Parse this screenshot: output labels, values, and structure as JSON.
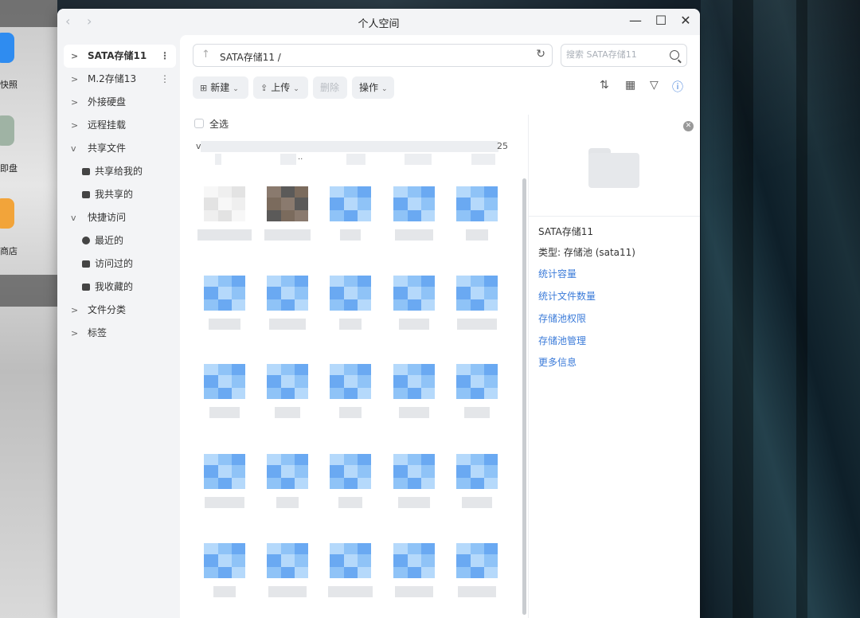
{
  "window": {
    "title": "个人空间",
    "controls": {
      "minimize": "—",
      "maximize": "☐",
      "close": "✕"
    }
  },
  "desktop": {
    "labels": [
      "快照",
      "即盘",
      "商店"
    ]
  },
  "sidebar": {
    "items": [
      {
        "label": "SATA存储11",
        "active": true,
        "has_more": true
      },
      {
        "label": "M.2存储13",
        "has_more": true
      },
      {
        "label": "外接硬盘"
      },
      {
        "label": "远程挂载"
      },
      {
        "label": "共享文件",
        "expanded": true
      },
      {
        "label": "共享给我的",
        "sub": true,
        "icon": "share-in-icon"
      },
      {
        "label": "我共享的",
        "sub": true,
        "icon": "share-out-icon"
      },
      {
        "label": "快捷访问",
        "expanded": true
      },
      {
        "label": "最近的",
        "sub": true,
        "icon": "clock-icon"
      },
      {
        "label": "访问过的",
        "sub": true,
        "icon": "visited-folder-icon"
      },
      {
        "label": "我收藏的",
        "sub": true,
        "icon": "star-folder-icon"
      },
      {
        "label": "文件分类"
      },
      {
        "label": "标签"
      }
    ]
  },
  "pathbar": {
    "path": "SATA存储11 /"
  },
  "search": {
    "placeholder": "搜索 SATA存储11"
  },
  "toolbar": {
    "new_label": "新建",
    "upload_label": "上传",
    "delete_label": "删除",
    "actions_label": "操作"
  },
  "file_area": {
    "select_all_label": "全选",
    "partial_text_left": "v",
    "partial_text_right": "25",
    "partial_text_mid": ".."
  },
  "details": {
    "name": "SATA存储11",
    "type_label": "类型:",
    "type_value": "存储池 (sata11)",
    "links": [
      "统计容量",
      "统计文件数量",
      "存储池权限",
      "存储池管理",
      "更多信息"
    ]
  },
  "colors": {
    "accent": "#3b7bd9",
    "thumb_blue": "#8fc3f7"
  }
}
